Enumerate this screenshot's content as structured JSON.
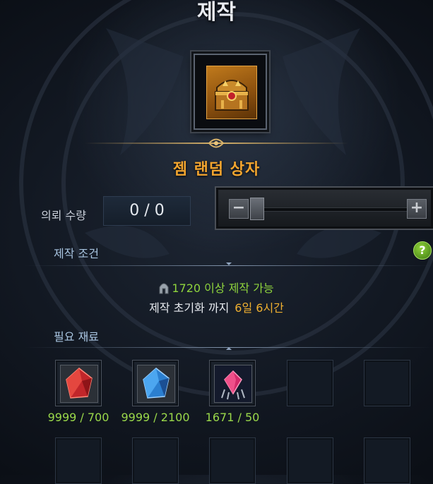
{
  "window": {
    "title": "제작"
  },
  "item": {
    "name": "젬 랜덤 상자",
    "icon": "treasure-chest-icon",
    "accent_color": "#f3a52f"
  },
  "quantity": {
    "label": "의뢰 수량",
    "value": "0 / 0",
    "minus": "−",
    "plus": "+",
    "slider_level": 0
  },
  "conditions": {
    "title": "제작 조건",
    "help": "?",
    "requirement": "1720 이상 제작 가능",
    "reset_label": "제작 초기화 까지",
    "reset_time": "6일 6시간"
  },
  "materials": {
    "title": "필요 재료",
    "items": [
      {
        "icon": "red-gem-icon",
        "count": "9999 / 700"
      },
      {
        "icon": "blue-gem-icon",
        "count": "9999 / 2100"
      },
      {
        "icon": "pink-crystal-icon",
        "count": "1671 / 50"
      }
    ],
    "count_color": "#9ad84a"
  }
}
